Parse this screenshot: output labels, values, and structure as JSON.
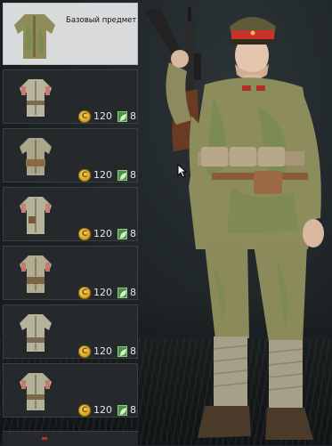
{
  "panel": {
    "base_item_label": "Базовый предмет",
    "items": [
      {
        "price": "120",
        "count": "8"
      },
      {
        "price": "120",
        "count": "8"
      },
      {
        "price": "120",
        "count": "8"
      },
      {
        "price": "120",
        "count": "8"
      },
      {
        "price": "120",
        "count": "8"
      },
      {
        "price": "120",
        "count": "8"
      }
    ]
  },
  "icons": {
    "currency": "gold-coin-icon",
    "order": "green-leaf-icon"
  },
  "colors": {
    "panel_bg": "#25292c",
    "base_bg": "#d9dadb",
    "coin": "#d9a61e",
    "leaf": "#4c8f46",
    "cap_band": "#c8322a"
  }
}
